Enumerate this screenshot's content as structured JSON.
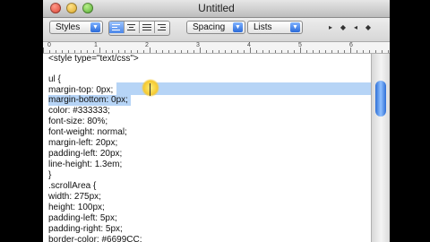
{
  "window": {
    "title": "Untitled"
  },
  "toolbar": {
    "styles_label": "Styles",
    "spacing_label": "Spacing",
    "lists_label": "Lists"
  },
  "ruler": {
    "numbers": [
      "0",
      "1",
      "2",
      "3",
      "4",
      "5",
      "6"
    ]
  },
  "editor": {
    "lines": [
      "<style type=\"text/css\">",
      "",
      "ul {",
      "margin-top: 0px;",
      "margin-bottom: 0px;",
      "color: #333333;",
      "font-size: 80%;",
      "font-weight: normal;",
      "margin-left: 20px;",
      "padding-left: 20px;",
      "line-height: 1.3em;",
      "}",
      ".scrollArea {",
      "width: 275px;",
      "height: 100px;",
      "padding-left: 5px;",
      "padding-right: 5px;",
      "border-color: #6699CC;"
    ]
  }
}
